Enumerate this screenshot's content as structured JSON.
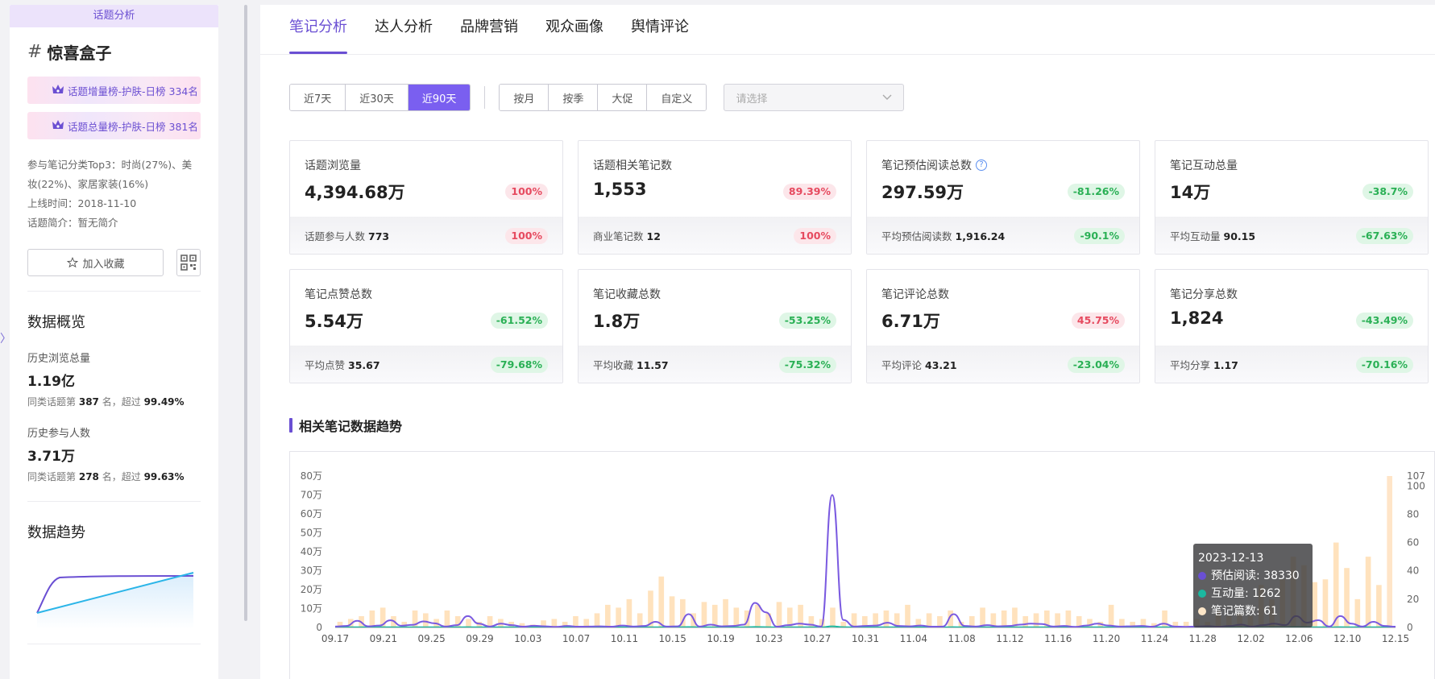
{
  "left": {
    "tag": "话题分析",
    "title": "惊喜盒子",
    "ranks": [
      "话题增量榜-护肤-日榜 334名",
      "话题总量榜-护肤-日榜 381名"
    ],
    "meta": {
      "top3": "参与笔记分类Top3：时尚(27%)、美妆(22%)、家居家装(16%)",
      "online": "上线时间：2018-11-10",
      "intro": "话题简介：暂无简介"
    },
    "fav_label": "加入收藏",
    "overview_title": "数据概览",
    "history_views_label": "历史浏览总量",
    "history_views_value": "1.19亿",
    "history_views_rank": "387",
    "history_views_pct": "99.49%",
    "history_users_label": "历史参与人数",
    "history_users_value": "3.71万",
    "history_users_rank": "278",
    "history_users_pct": "99.63%",
    "rank_prefix": "同类话题第",
    "rank_mid": "名，超过",
    "trend_title": "数据趋势"
  },
  "tabs": [
    "笔记分析",
    "达人分析",
    "品牌营销",
    "观众画像",
    "舆情评论"
  ],
  "filters": {
    "range": [
      "近7天",
      "近30天",
      "近90天"
    ],
    "range_selected": 2,
    "period": [
      "按月",
      "按季",
      "大促",
      "自定义"
    ],
    "select_placeholder": "请选择"
  },
  "cards": [
    {
      "title": "话题浏览量",
      "value": "4,394.68万",
      "change": "100%",
      "dir": "up",
      "sub_label": "话题参与人数",
      "sub_value": "773",
      "sub_change": "100%",
      "sub_dir": "up"
    },
    {
      "title": "话题相关笔记数",
      "value": "1,553",
      "change": "89.39%",
      "dir": "up",
      "sub_label": "商业笔记数",
      "sub_value": "12",
      "sub_change": "100%",
      "sub_dir": "up"
    },
    {
      "title": "笔记预估阅读总数",
      "value": "297.59万",
      "change": "-81.26%",
      "dir": "down",
      "sub_label": "平均预估阅读数",
      "sub_value": "1,916.24",
      "sub_change": "-90.1%",
      "sub_dir": "down",
      "help": true
    },
    {
      "title": "笔记互动总量",
      "value": "14万",
      "change": "-38.7%",
      "dir": "down",
      "sub_label": "平均互动量",
      "sub_value": "90.15",
      "sub_change": "-67.63%",
      "sub_dir": "down"
    },
    {
      "title": "笔记点赞总数",
      "value": "5.54万",
      "change": "-61.52%",
      "dir": "down",
      "sub_label": "平均点赞",
      "sub_value": "35.67",
      "sub_change": "-79.68%",
      "sub_dir": "down"
    },
    {
      "title": "笔记收藏总数",
      "value": "1.8万",
      "change": "-53.25%",
      "dir": "down",
      "sub_label": "平均收藏",
      "sub_value": "11.57",
      "sub_change": "-75.32%",
      "sub_dir": "down"
    },
    {
      "title": "笔记评论总数",
      "value": "6.71万",
      "change": "45.75%",
      "dir": "up",
      "sub_label": "平均评论",
      "sub_value": "43.21",
      "sub_change": "-23.04%",
      "sub_dir": "down"
    },
    {
      "title": "笔记分享总数",
      "value": "1,824",
      "change": "-43.49%",
      "dir": "down",
      "sub_label": "平均分享",
      "sub_value": "1.17",
      "sub_change": "-70.16%",
      "sub_dir": "down"
    }
  ],
  "chart_title": "相关笔记数据趋势",
  "tooltip": {
    "date": "2023-12-13",
    "items": [
      {
        "label": "预估阅读: 38330",
        "color": "#6a4fd3"
      },
      {
        "label": "互动量: 1262",
        "color": "#1bb8a0"
      },
      {
        "label": "笔记篇数: 61",
        "color": "#fde6c8"
      }
    ]
  },
  "colors": {
    "accent": "#6a4fd3",
    "reads": "#7a5ae0",
    "interact": "#1bb8a0",
    "notes_bar": "#ffe2bd"
  },
  "chart_data": {
    "type": "bar",
    "x_ticks": [
      "09.17",
      "09.21",
      "09.25",
      "09.29",
      "10.03",
      "10.07",
      "10.11",
      "10.15",
      "10.19",
      "10.23",
      "10.27",
      "10.31",
      "11.04",
      "11.08",
      "11.12",
      "11.16",
      "11.20",
      "11.24",
      "11.28",
      "12.02",
      "12.06",
      "12.10",
      "12.15"
    ],
    "y_left_ticks": [
      "0",
      "10万",
      "20万",
      "30万",
      "40万",
      "50万",
      "60万",
      "70万",
      "80万"
    ],
    "y_left_lim": [
      0,
      800000
    ],
    "y_right_ticks": [
      "0",
      "20",
      "40",
      "60",
      "80",
      "100",
      "107"
    ],
    "y_right_lim": [
      0,
      107
    ],
    "series": [
      {
        "name": "笔记篇数",
        "type": "bar",
        "axis": "right",
        "values": [
          4,
          6,
          8,
          12,
          14,
          8,
          4,
          12,
          10,
          6,
          12,
          8,
          6,
          4,
          8,
          6,
          4,
          3,
          2,
          5,
          6,
          4,
          8,
          6,
          10,
          16,
          14,
          20,
          10,
          26,
          36,
          22,
          20,
          10,
          18,
          16,
          20,
          14,
          12,
          16,
          10,
          18,
          14,
          16,
          8,
          6,
          14,
          4,
          10,
          8,
          10,
          12,
          10,
          16,
          6,
          10,
          8,
          12,
          4,
          8,
          14,
          10,
          12,
          14,
          8,
          10,
          12,
          10,
          12,
          8,
          6,
          4,
          16,
          6,
          4,
          6,
          3,
          12,
          4,
          4,
          6,
          4,
          12,
          8,
          10,
          8,
          30,
          20,
          34,
          50,
          44,
          32,
          34,
          60,
          42,
          20,
          50,
          30,
          107
        ]
      },
      {
        "name": "预估阅读",
        "type": "line",
        "axis": "left",
        "values": [
          5000,
          8000,
          35000,
          6000,
          10000,
          38000,
          9000,
          14000,
          32000,
          22000,
          5000,
          12000,
          60000,
          20000,
          5000,
          20000,
          12000,
          4000,
          9000,
          6000,
          3000,
          8000,
          4000,
          5000,
          6000,
          4000,
          10000,
          5000,
          8000,
          30000,
          5000,
          6000,
          70000,
          5000,
          15000,
          6000,
          8000,
          15000,
          130000,
          80000,
          4000,
          12000,
          20000,
          15000,
          5000,
          700000,
          40000,
          5000,
          8000,
          10000,
          25000,
          8000,
          6000,
          10000,
          4000,
          5000,
          70000,
          8000,
          5000,
          12000,
          6000,
          8000,
          15000,
          20000,
          18000,
          5000,
          8000,
          3000,
          10000,
          20000,
          10000,
          5000,
          6000,
          8000,
          4000,
          20000,
          5000,
          3000,
          5000,
          7000,
          4000,
          8000,
          15000,
          5000,
          12000,
          20000,
          12000,
          60000,
          25000,
          38330,
          5000,
          60000,
          20000,
          5000,
          30000,
          8000,
          4000
        ]
      },
      {
        "name": "互动量",
        "type": "line",
        "axis": "left",
        "values": [
          800,
          900,
          1200,
          900,
          1500,
          1000,
          800,
          1300,
          900,
          1100,
          800,
          900,
          1600,
          1000,
          700,
          1200,
          900,
          600,
          800,
          700,
          600,
          800,
          500,
          600,
          700,
          500,
          900,
          600,
          800,
          1300,
          700,
          600,
          2200,
          700,
          900,
          600,
          700,
          1100,
          2500,
          1800,
          600,
          900,
          1000,
          1100,
          700,
          6000,
          1500,
          700,
          800,
          900,
          1200,
          800,
          600,
          900,
          500,
          600,
          1800,
          800,
          600,
          900,
          600,
          800,
          900,
          1100,
          1000,
          600,
          800,
          500,
          900,
          1100,
          900,
          600,
          700,
          800,
          500,
          1100,
          600,
          500,
          600,
          700,
          500,
          800,
          900,
          600,
          900,
          1200,
          900,
          1800,
          1200,
          1262,
          600,
          1500,
          1000,
          600,
          1300,
          700,
          500
        ]
      }
    ],
    "tooltip_date": "2023-12-13"
  }
}
